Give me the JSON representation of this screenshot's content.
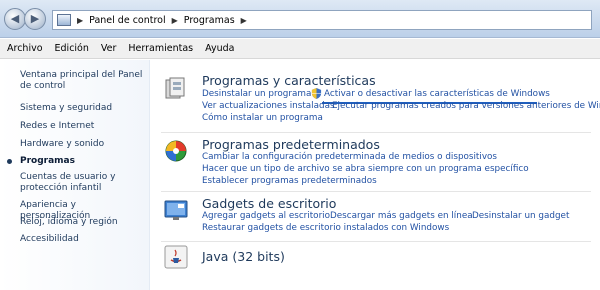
{
  "addressbar": {
    "breadcrumb": [
      "Panel de control",
      "Programas"
    ]
  },
  "menu": [
    "Archivo",
    "Edición",
    "Ver",
    "Herramientas",
    "Ayuda"
  ],
  "sidebar": {
    "items": [
      {
        "label": "Ventana principal del Panel de control"
      },
      {
        "label": "Sistema y seguridad"
      },
      {
        "label": "Redes e Internet"
      },
      {
        "label": "Hardware y sonido"
      },
      {
        "label": "Programas"
      },
      {
        "label": "Cuentas de usuario y protección infantil"
      },
      {
        "label": "Apariencia y personalización"
      },
      {
        "label": "Reloj, idioma y región"
      },
      {
        "label": "Accesibilidad"
      }
    ]
  },
  "sections": [
    {
      "title": "Programas y características",
      "links": [
        "Desinstalar un programa",
        "Activar o desactivar las características de Windows",
        "Ver actualizaciones instaladas",
        "Ejecutar programas creados para versiones anteriores de Windows",
        "Cómo instalar un programa"
      ]
    },
    {
      "title": "Programas predeterminados",
      "links": [
        "Cambiar la configuración predeterminada de medios o dispositivos",
        "Hacer que un tipo de archivo se abra siempre con un programa específico",
        "Establecer programas predeterminados"
      ]
    },
    {
      "title": "Gadgets de escritorio",
      "links": [
        "Agregar gadgets al escritorio",
        "Descargar más gadgets en línea",
        "Desinstalar un gadget",
        "Restaurar gadgets de escritorio instalados con Windows"
      ]
    },
    {
      "title": "Java (32 bits)",
      "links": []
    }
  ],
  "colors": {
    "link": "#2251a3",
    "title": "#1e395b",
    "selection_underline": "#1f5fbf"
  },
  "icons": [
    "back-arrow-icon",
    "forward-arrow-icon",
    "control-panel-icon",
    "programs-icon",
    "shield-icon",
    "default-programs-icon",
    "gadgets-icon",
    "java-icon"
  ]
}
